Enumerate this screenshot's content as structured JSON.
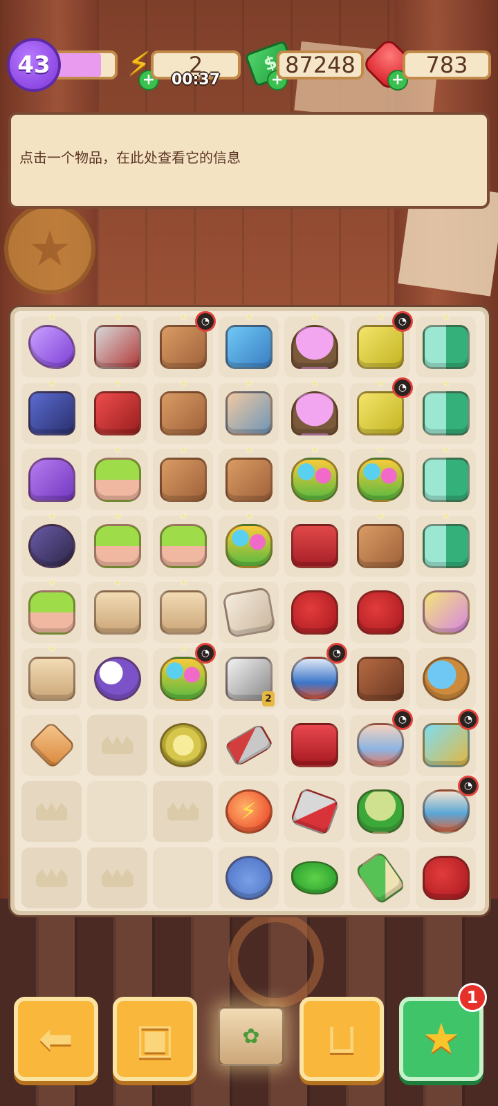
{
  "hud": {
    "level": "43",
    "level_progress_fraction": 0.78,
    "energy": "2",
    "energy_timer": "00:37",
    "cash": "87248",
    "gems": "783"
  },
  "info_panel": {
    "text": "点击一个物品，在此处查看它的信息"
  },
  "board": {
    "rows": [
      [
        {
          "item": "plane",
          "star": true
        },
        {
          "item": "tool",
          "star": true
        },
        {
          "item": "crate",
          "star": true,
          "locked": true
        },
        {
          "item": "building",
          "star": true
        },
        {
          "item": "tree",
          "star": true
        },
        {
          "item": "cart",
          "star": true,
          "locked": true
        },
        {
          "item": "bottles",
          "star": true
        }
      ],
      [
        {
          "item": "jeep",
          "star": true
        },
        {
          "item": "red-device",
          "star": true
        },
        {
          "item": "crate",
          "star": true
        },
        {
          "item": "safe",
          "star": true
        },
        {
          "item": "tree",
          "star": true
        },
        {
          "item": "cart",
          "star": true,
          "locked": true
        },
        {
          "item": "bottles",
          "star": true
        }
      ],
      [
        {
          "item": "car",
          "star": false
        },
        {
          "item": "plant",
          "star": true
        },
        {
          "item": "crate",
          "star": true
        },
        {
          "item": "crate",
          "star": true
        },
        {
          "item": "flowers",
          "star": true
        },
        {
          "item": "flowers",
          "star": true
        },
        {
          "item": "bottles",
          "star": true
        }
      ],
      [
        {
          "item": "moto",
          "star": true
        },
        {
          "item": "plant",
          "star": true
        },
        {
          "item": "plant",
          "star": true
        },
        {
          "item": "flowers",
          "star": true
        },
        {
          "item": "toolbox",
          "star": false
        },
        {
          "item": "crate",
          "star": true
        },
        {
          "item": "bottles",
          "star": true
        }
      ],
      [
        {
          "item": "plant",
          "star": true
        },
        {
          "item": "box-bulb",
          "star": true
        },
        {
          "item": "box-sign",
          "star": true
        },
        {
          "item": "paper",
          "star": false
        },
        {
          "item": "gloves",
          "star": false
        },
        {
          "item": "gloves",
          "star": false
        },
        {
          "item": "spray",
          "star": false
        }
      ],
      [
        {
          "item": "box-plant",
          "star": true
        },
        {
          "item": "lamp",
          "star": false
        },
        {
          "item": "flowers",
          "star": true,
          "locked": true
        },
        {
          "item": "print",
          "star": false,
          "count": "2"
        },
        {
          "item": "vase",
          "star": false,
          "locked": true
        },
        {
          "item": "cards",
          "star": false
        },
        {
          "item": "magnifier",
          "star": false
        }
      ],
      [
        {
          "item": "hourglass",
          "star": false
        },
        {
          "item": "empty"
        },
        {
          "item": "hose",
          "star": false
        },
        {
          "item": "trowel",
          "star": false
        },
        {
          "item": "sink",
          "star": false
        },
        {
          "item": "vase2",
          "star": false,
          "locked": true
        },
        {
          "item": "chest",
          "star": false,
          "locked": true
        }
      ],
      [
        {
          "item": "empty"
        },
        {
          "item": "blank"
        },
        {
          "item": "empty"
        },
        {
          "item": "energy",
          "star": false
        },
        {
          "item": "shears",
          "star": false
        },
        {
          "item": "sponge-pad",
          "star": false
        },
        {
          "item": "vase3",
          "star": false,
          "locked": true
        }
      ],
      [
        {
          "item": "empty"
        },
        {
          "item": "empty"
        },
        {
          "item": "blank"
        },
        {
          "item": "koala",
          "star": false
        },
        {
          "item": "sponge",
          "star": false
        },
        {
          "item": "brush",
          "star": false
        },
        {
          "item": "gloves",
          "star": false
        }
      ]
    ]
  },
  "bottom_bar": {
    "back_icon": "arrow-left-icon",
    "bag_icon": "backpack-icon",
    "center_item": "box-plant",
    "basket_icon": "basket-icon",
    "star_icon": "star-icon",
    "star_badge": "1"
  },
  "colors": {
    "panel": "#f4e3c3",
    "button_orange": "#f9b73b",
    "button_green": "#3fc46a",
    "level_purple": "#9b5cf0"
  }
}
